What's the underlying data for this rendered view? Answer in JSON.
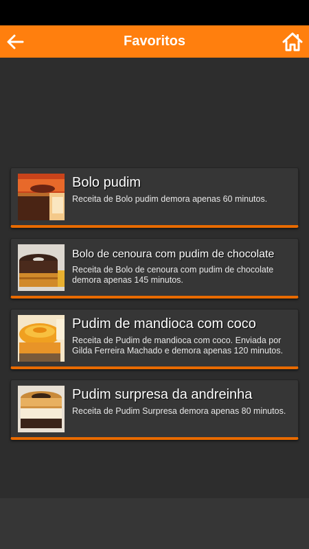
{
  "header": {
    "title": "Favoritos",
    "back_icon": "arrow-left-icon",
    "home_icon": "home-icon",
    "bg_color": "#ff7f0e"
  },
  "recipes": [
    {
      "title": "Bolo pudim",
      "description": "Receita de Bolo pudim demora apenas 60 minutos."
    },
    {
      "title": "Bolo de cenoura com pudim de chocolate",
      "description": "Receita de Bolo de cenoura com pudim de chocolate demora apenas 145 minutos."
    },
    {
      "title": "Pudim de mandioca com coco",
      "description": "Receita de Pudim de mandioca com coco. Enviada por Gilda Ferreira Machado e demora apenas 120 minutos."
    },
    {
      "title": "Pudim surpresa da andreinha",
      "description": "Receita de Pudim Surpresa demora apenas 80 minutos."
    }
  ],
  "accent_color": "#e86a00"
}
